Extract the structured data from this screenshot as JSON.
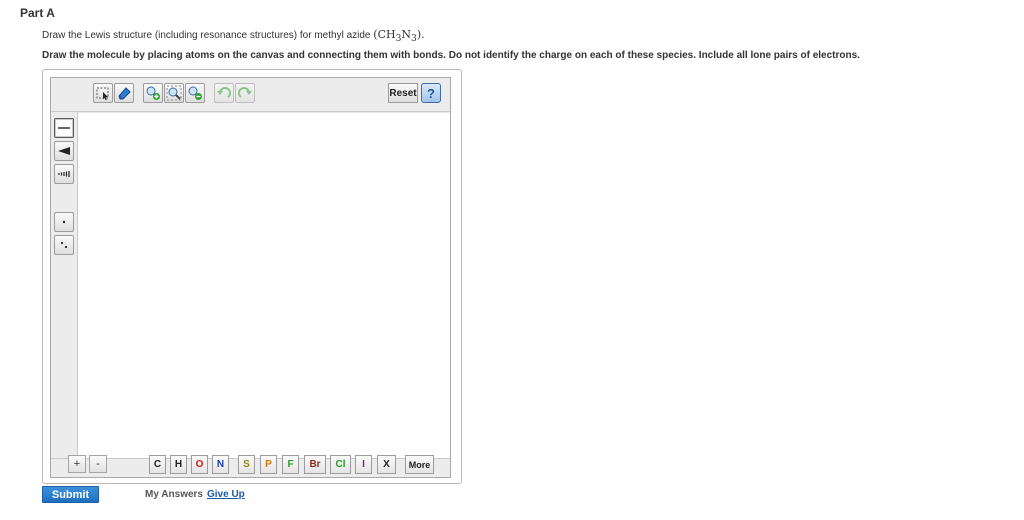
{
  "part": {
    "title": "Part A"
  },
  "question": {
    "prompt_text": "Draw the Lewis structure (including resonance structures) for methyl azide",
    "formula_open": "(",
    "formula_ch": "CH",
    "formula_ch_sub": "3",
    "formula_n": "N",
    "formula_n_sub": "3",
    "formula_close": ").",
    "instructions": "Draw the molecule by placing atoms on the canvas and connecting them with bonds. Do not identify the charge on each of these species. Include all lone pairs of electrons."
  },
  "toolbar": {
    "icons": [
      "select-lasso-icon",
      "eraser-icon",
      "zoom-in-icon",
      "zoom-fit-icon",
      "zoom-out-icon",
      "undo-icon",
      "redo-icon"
    ],
    "reset_label": "Reset",
    "help_label": "?"
  },
  "left_tools": {
    "icons": [
      "single-bond-icon",
      "wedge-bond-icon",
      "dash-bond-icon",
      "lone-pair-icon",
      "radical-icon"
    ]
  },
  "bottom_bar": {
    "plus_label": "+",
    "minus_label": "-",
    "atoms": [
      {
        "symbol": "C",
        "color": "#222222"
      },
      {
        "symbol": "H",
        "color": "#222222"
      },
      {
        "symbol": "O",
        "color": "#d11a1a"
      },
      {
        "symbol": "N",
        "color": "#1a3fb0"
      },
      {
        "symbol": "S",
        "color": "#8a8a1a"
      },
      {
        "symbol": "P",
        "color": "#d07a10"
      },
      {
        "symbol": "F",
        "color": "#2aa02a"
      },
      {
        "symbol": "Br",
        "color": "#8a2a1a"
      },
      {
        "symbol": "Cl",
        "color": "#20a020"
      },
      {
        "symbol": "I",
        "color": "#6a2a9a"
      },
      {
        "symbol": "X",
        "color": "#222222"
      }
    ],
    "more_label": "More"
  },
  "actions": {
    "submit_label": "Submit",
    "my_answers_label": "My Answers",
    "give_up_label": "Give Up"
  },
  "colors": {
    "submit_blue": "#2a7fd0",
    "link_blue": "#1a5aa8",
    "help_blue": "#1a58a8"
  }
}
